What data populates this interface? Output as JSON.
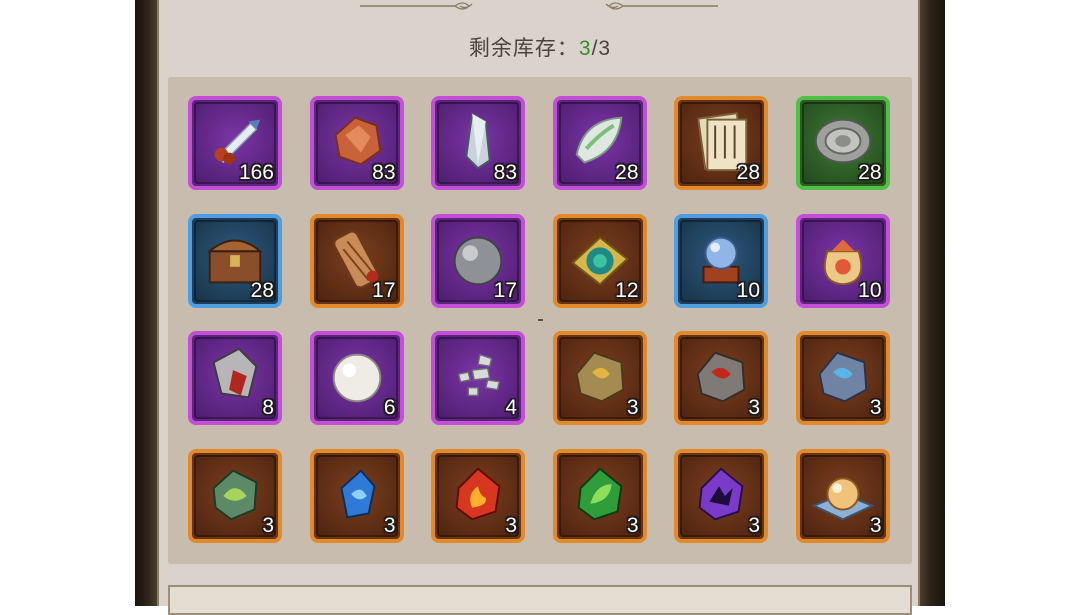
{
  "stock": {
    "label": "剩余库存：",
    "current": "3",
    "separator": "/",
    "total": "3"
  },
  "colors": {
    "purple": "#c24fd6",
    "orange": "#e08a2c",
    "blue": "#4f9ee0",
    "green": "#4fbf45"
  },
  "items": [
    {
      "icon": "scroll-tube-icon",
      "rarity": "purple",
      "count": "166"
    },
    {
      "icon": "copper-ore-icon",
      "rarity": "purple",
      "count": "83"
    },
    {
      "icon": "crystal-shard-icon",
      "rarity": "purple",
      "count": "83"
    },
    {
      "icon": "jade-leaf-icon",
      "rarity": "purple",
      "count": "28"
    },
    {
      "icon": "manual-book-icon",
      "rarity": "orange",
      "count": "28"
    },
    {
      "icon": "stone-disc-icon",
      "rarity": "green",
      "count": "28"
    },
    {
      "icon": "treasure-chest-icon",
      "rarity": "blue",
      "count": "28"
    },
    {
      "icon": "bamboo-scroll-icon",
      "rarity": "orange",
      "count": "17"
    },
    {
      "icon": "iron-ball-icon",
      "rarity": "purple",
      "count": "17"
    },
    {
      "icon": "jade-talisman-icon",
      "rarity": "orange",
      "count": "12"
    },
    {
      "icon": "crystal-orb-icon",
      "rarity": "blue",
      "count": "10"
    },
    {
      "icon": "lucky-bag-icon",
      "rarity": "purple",
      "count": "10"
    },
    {
      "icon": "red-crystal-rock-icon",
      "rarity": "purple",
      "count": "8"
    },
    {
      "icon": "pearl-icon",
      "rarity": "purple",
      "count": "6"
    },
    {
      "icon": "stone-fragments-icon",
      "rarity": "purple",
      "count": "4"
    },
    {
      "icon": "gold-rune-stone-icon",
      "rarity": "orange",
      "count": "3"
    },
    {
      "icon": "red-rune-stone-icon",
      "rarity": "orange",
      "count": "3"
    },
    {
      "icon": "blue-rune-stone-icon",
      "rarity": "orange",
      "count": "3"
    },
    {
      "icon": "green-spirit-gem-icon",
      "rarity": "orange",
      "count": "3"
    },
    {
      "icon": "blue-spirit-gem-icon",
      "rarity": "orange",
      "count": "3"
    },
    {
      "icon": "fire-gem-icon",
      "rarity": "orange",
      "count": "3"
    },
    {
      "icon": "leaf-gem-icon",
      "rarity": "orange",
      "count": "3"
    },
    {
      "icon": "purple-beast-gem-icon",
      "rarity": "orange",
      "count": "3"
    },
    {
      "icon": "golden-orb-icon",
      "rarity": "orange",
      "count": "3"
    }
  ]
}
